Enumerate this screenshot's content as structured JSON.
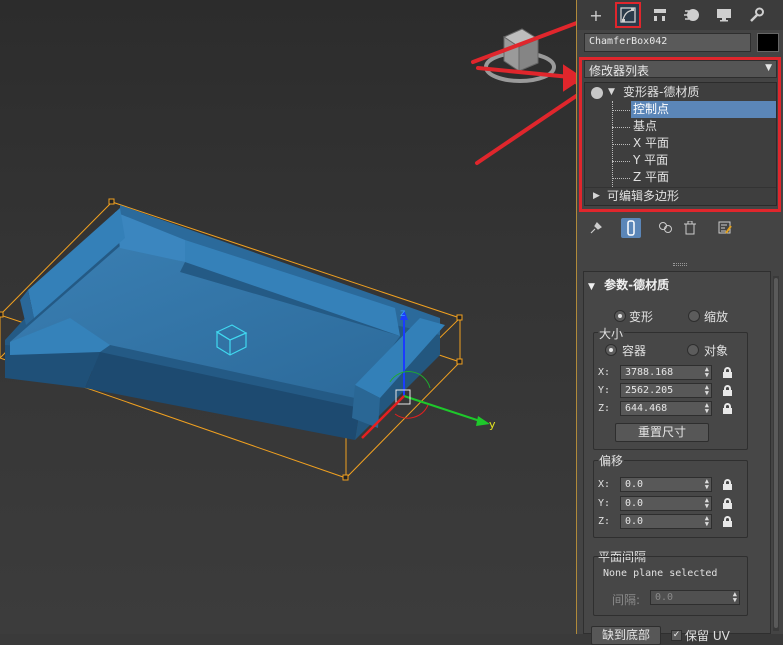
{
  "toolbar": {
    "tabs": [
      {
        "icon": "create-icon",
        "glyph": "+"
      },
      {
        "icon": "modify-icon",
        "glyph": "◪"
      },
      {
        "icon": "hierarchy-icon",
        "glyph": "⊓"
      },
      {
        "icon": "motion-icon",
        "glyph": "◐"
      },
      {
        "icon": "display-icon",
        "glyph": "▬"
      },
      {
        "icon": "utilities-icon",
        "glyph": "🔧"
      }
    ],
    "active_tab": "modify"
  },
  "object": {
    "name": "ChamferBox042",
    "color": "#000000"
  },
  "modifier_list": {
    "label": "修改器列表"
  },
  "stack": {
    "items": [
      {
        "label": "变形器-德材质"
      },
      {
        "label": "控制点"
      },
      {
        "label": "基点"
      },
      {
        "label": "X 平面"
      },
      {
        "label": "Y 平面"
      },
      {
        "label": "Z 平面"
      },
      {
        "label": "可编辑多边形"
      }
    ]
  },
  "rollout": {
    "title": "参数-德材质",
    "mode": {
      "deform": "变形",
      "scale": "缩放"
    },
    "size": {
      "label": "大小",
      "container": "容器",
      "object": "对象",
      "x_label": "X:",
      "x": "3788.168",
      "y_label": "Y:",
      "y": "2562.205",
      "z_label": "Z:",
      "z": "644.468",
      "reset": "重置尺寸"
    },
    "offset": {
      "label": "偏移",
      "x_label": "X:",
      "x": "0.0",
      "y_label": "Y:",
      "y": "0.0",
      "z_label": "Z:",
      "z": "0.0"
    },
    "plane_spacing": {
      "label": "平面间隔",
      "status": "None plane selected",
      "spacing_label": "间隔:",
      "spacing": "0.0"
    },
    "bottom": {
      "button": "缺到底部",
      "checkbox": "保留 UV"
    }
  },
  "viewport": {
    "axis_z": "z",
    "axis_y": "y"
  },
  "colors": {
    "sofa": "#2e6e9e",
    "selection_box": "#f0a020",
    "highlight": "#e0262c",
    "selected_row": "#5b86b8"
  }
}
